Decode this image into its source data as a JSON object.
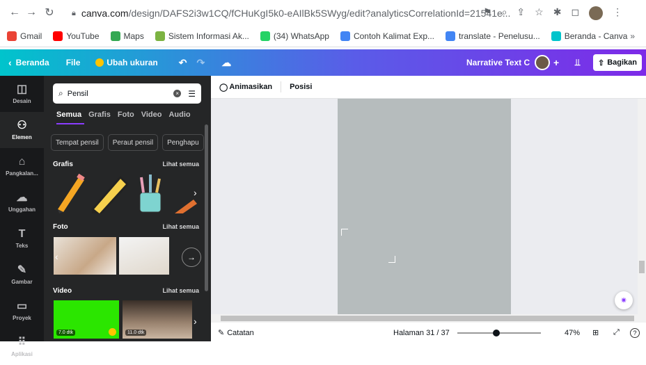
{
  "browser": {
    "url_domain": "canva.com",
    "url_path": "/design/DAFS2i3w1CQ/fCHuKgI5k0-eAIlBk5SWyg/edit?analyticsCorrelationId=21541e...",
    "bookmarks": [
      {
        "label": "Gmail",
        "color": "#ea4335"
      },
      {
        "label": "YouTube",
        "color": "#ff0000"
      },
      {
        "label": "Maps",
        "color": "#34a853"
      },
      {
        "label": "Sistem Informasi Ak...",
        "color": "#7cb342"
      },
      {
        "label": "(34) WhatsApp",
        "color": "#25d366"
      },
      {
        "label": "Contoh Kalimat Exp...",
        "color": "#4285f4"
      },
      {
        "label": "translate - Penelusu...",
        "color": "#4285f4"
      },
      {
        "label": "Beranda - Canva",
        "color": "#00c4cc"
      }
    ],
    "more": "»"
  },
  "toolbar": {
    "home": "Beranda",
    "file": "File",
    "resize": "Ubah ukuran",
    "title": "Narrative Text C",
    "share": "Bagikan"
  },
  "rail": [
    {
      "label": "Desain",
      "icon": "◫"
    },
    {
      "label": "Elemen",
      "icon": "⚇"
    },
    {
      "label": "Pangkalan...",
      "icon": "⌂"
    },
    {
      "label": "Unggahan",
      "icon": "☁"
    },
    {
      "label": "Teks",
      "icon": "T"
    },
    {
      "label": "Gambar",
      "icon": "✎"
    },
    {
      "label": "Proyek",
      "icon": "▭"
    },
    {
      "label": "Aplikasi",
      "icon": "⠿"
    }
  ],
  "panel": {
    "search_value": "Pensil",
    "tabs": [
      "Semua",
      "Grafis",
      "Foto",
      "Video",
      "Audio"
    ],
    "chips": [
      "Tempat pensil",
      "Peraut pensil",
      "Penghapu"
    ],
    "sections": {
      "grafis": {
        "title": "Grafis",
        "see_all": "Lihat semua"
      },
      "foto": {
        "title": "Foto",
        "see_all": "Lihat semua"
      },
      "video": {
        "title": "Video",
        "see_all": "Lihat semua"
      }
    },
    "video_durations": [
      "7.0 dtk",
      "11.0 dtk"
    ]
  },
  "editor": {
    "animate": "Animasikan",
    "position": "Posisi"
  },
  "footer": {
    "notes": "Catatan",
    "page": "Halaman 31 / 37",
    "zoom": "47%",
    "zoom_level": 0.47,
    "help": "?"
  }
}
